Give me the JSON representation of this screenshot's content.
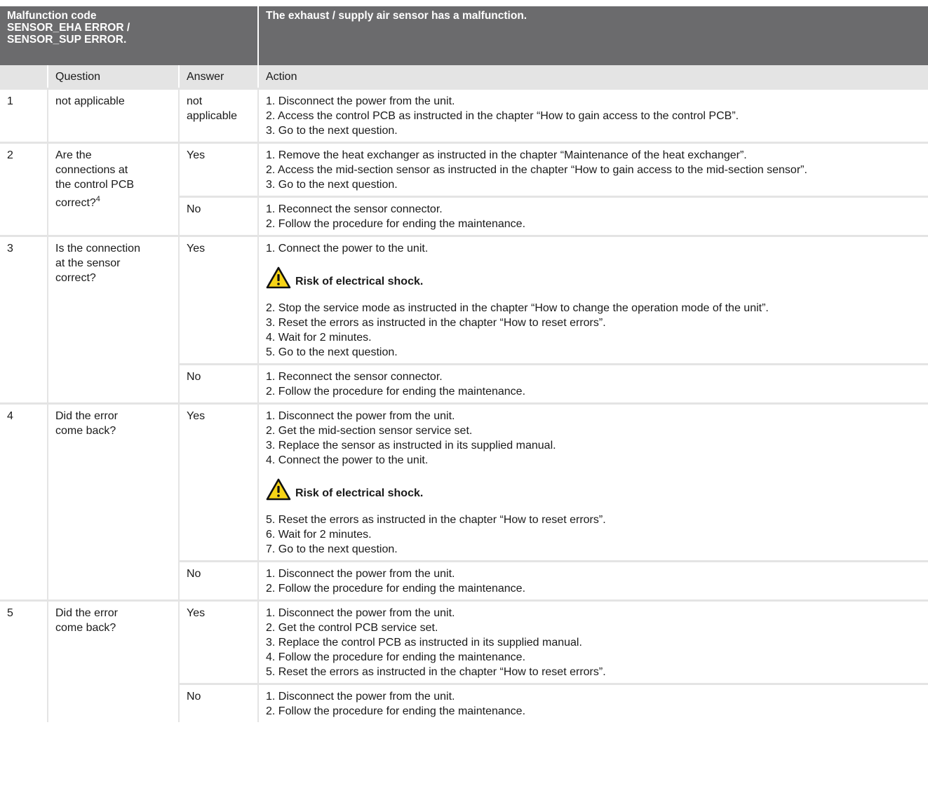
{
  "header": {
    "code_label": "Malfunction code",
    "code_line2": "SENSOR_EHA ERROR /",
    "code_line3": "SENSOR_SUP ERROR.",
    "description": "The exhaust / supply air sensor has a malfunction."
  },
  "columns": {
    "num": "",
    "question": "Question",
    "answer": "Answer",
    "action": "Action"
  },
  "warning_text": "Risk of electrical shock.",
  "rows": [
    {
      "num": "1",
      "question": "not applicable",
      "answers": [
        {
          "answer_line1": "not",
          "answer_line2": "applicable",
          "steps": [
            "1. Disconnect the power from the unit.",
            "2. Access the control PCB as instructed in the chapter “How to gain access to the control PCB”.",
            "3. Go to the next question."
          ]
        }
      ]
    },
    {
      "num": "2",
      "question_line1": "Are the",
      "question_line2": "connections at",
      "question_line3": "the control PCB",
      "question_line4": "correct?",
      "footnote": "4",
      "answers": [
        {
          "answer": "Yes",
          "steps": [
            "1. Remove the heat exchanger as instructed in the chapter “Maintenance of the heat exchanger”.",
            "2. Access the mid-section sensor as instructed in the chapter “How to gain access to the mid-section sensor”.",
            "3. Go to the next question."
          ]
        },
        {
          "answer": "No",
          "steps": [
            "1. Reconnect the sensor connector.",
            "2. Follow the procedure for ending the maintenance."
          ]
        }
      ]
    },
    {
      "num": "3",
      "question_line1": "Is the connection",
      "question_line2": "at the sensor",
      "question_line3": "correct?",
      "answers": [
        {
          "answer": "Yes",
          "steps_before": [
            "1. Connect the power to the unit."
          ],
          "steps_after": [
            "2. Stop the service mode as instructed in the chapter “How to change the operation mode of the unit”.",
            "3. Reset the errors as instructed in the chapter “How to reset errors”.",
            "4. Wait for 2 minutes.",
            "5. Go to the next question."
          ]
        },
        {
          "answer": "No",
          "steps": [
            "1. Reconnect the sensor connector.",
            "2. Follow the procedure for ending the maintenance."
          ]
        }
      ]
    },
    {
      "num": "4",
      "question_line1": "Did the error",
      "question_line2": "come back?",
      "answers": [
        {
          "answer": "Yes",
          "steps_before": [
            "1. Disconnect the power from the unit.",
            "2. Get the mid-section sensor service set.",
            "3. Replace the sensor as instructed in its supplied manual.",
            "4. Connect the power to the unit."
          ],
          "steps_after": [
            "5. Reset the errors as instructed in the chapter “How to reset errors”.",
            "6. Wait for 2 minutes.",
            "7. Go to the next question."
          ]
        },
        {
          "answer": "No",
          "steps": [
            "1. Disconnect the power from the unit.",
            "2. Follow the procedure for ending the maintenance."
          ]
        }
      ]
    },
    {
      "num": "5",
      "question_line1": "Did the error",
      "question_line2": "come back?",
      "answers": [
        {
          "answer": "Yes",
          "steps": [
            "1. Disconnect the power from the unit.",
            "2. Get the control PCB service set.",
            "3. Replace the control PCB as instructed in its supplied manual.",
            "4. Follow the procedure for ending the maintenance.",
            "5. Reset the errors as instructed in the chapter “How to reset errors”."
          ]
        },
        {
          "answer": "No",
          "steps": [
            "1. Disconnect the power from the unit.",
            "2. Follow the procedure for ending the maintenance."
          ]
        }
      ]
    }
  ]
}
